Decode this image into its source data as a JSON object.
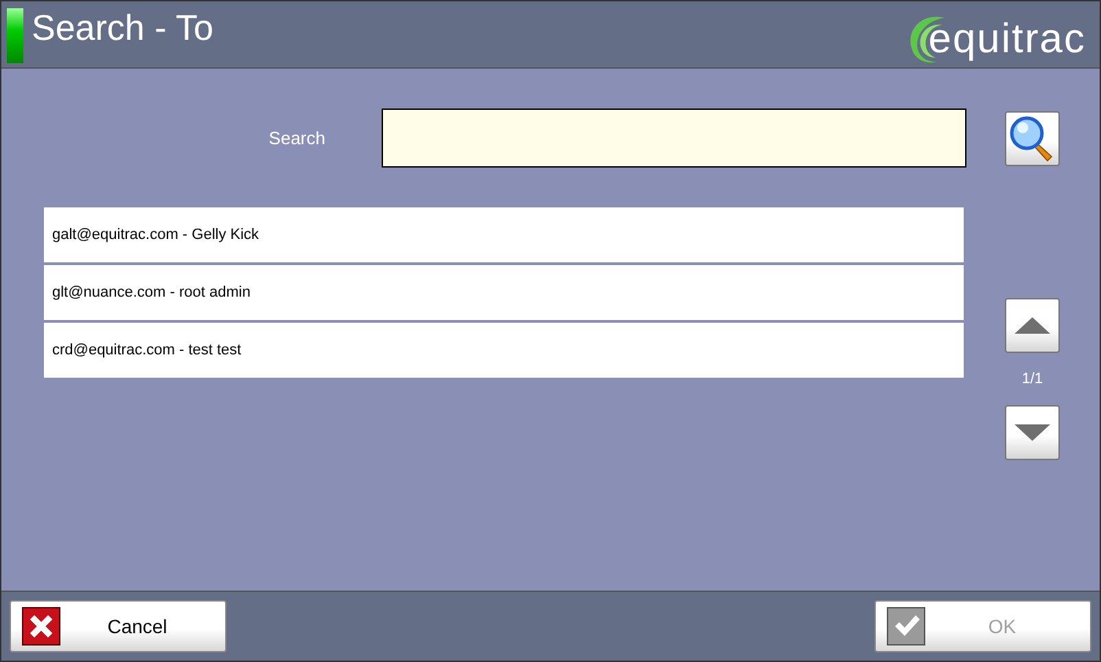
{
  "window": {
    "title": "Search - To"
  },
  "logo": {
    "text": "equitrac"
  },
  "search": {
    "label": "Search"
  },
  "results": [
    {
      "text": "galt@equitrac.com - Gelly Kick"
    },
    {
      "text": "glt@nuance.com - root admin"
    },
    {
      "text": "crd@equitrac.com - test test"
    }
  ],
  "pager": {
    "page": "1/1"
  },
  "buttons": [
    {
      "kind": "cancel",
      "label": "Cancel",
      "disabled": false
    },
    {
      "kind": "ok",
      "label": "OK",
      "disabled": true
    }
  ]
}
